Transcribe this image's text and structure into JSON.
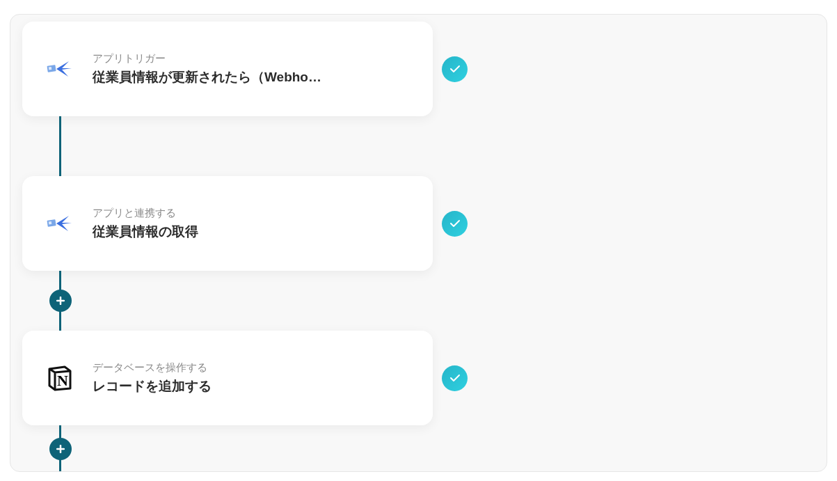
{
  "steps": [
    {
      "kind": "app",
      "category": "アプリトリガー",
      "title": "従業員情報が更新されたら（Webho…",
      "done": true,
      "add_button": false
    },
    {
      "kind": "app",
      "category": "アプリと連携する",
      "title": "従業員情報の取得",
      "done": true,
      "add_button": true
    },
    {
      "kind": "notion",
      "logo_text": "N",
      "category": "データベースを操作する",
      "title": "レコードを追加する",
      "done": true,
      "add_button": true
    }
  ]
}
